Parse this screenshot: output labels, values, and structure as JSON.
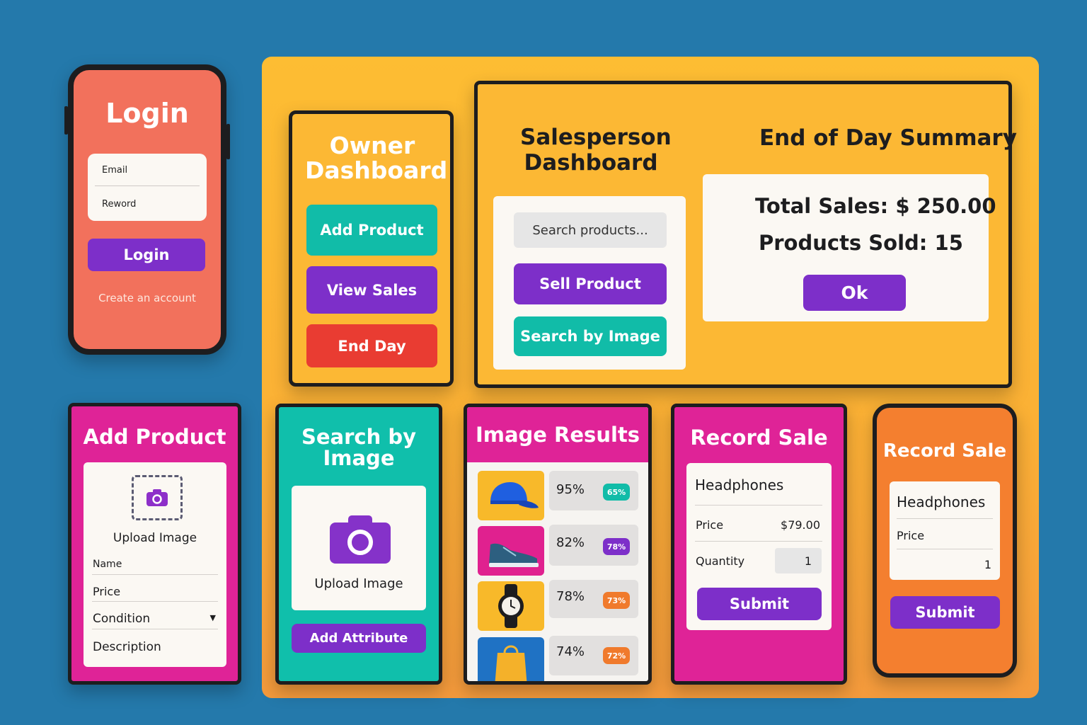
{
  "login": {
    "title": "Login",
    "email_placeholder": "Email",
    "password_placeholder": "Reword",
    "login_label": "Login",
    "create_account": "Create an account"
  },
  "owner": {
    "title": "Owner Dashboard",
    "add_product": "Add Product",
    "view_sales": "View Sales",
    "end_day": "End Day"
  },
  "salesperson": {
    "title": "Salesperson Dashboard",
    "search_placeholder": "Search products...",
    "sell_product": "Sell Product",
    "search_by_image": "Search by Image"
  },
  "summary": {
    "title": "End of Day Summary",
    "total_sales_label": "Total Sales:",
    "total_sales_value": "$ 250.00",
    "products_sold_label": "Products Sold:",
    "products_sold_value": "15",
    "ok": "Ok"
  },
  "add_product": {
    "title": "Add Product",
    "upload": "Upload Image",
    "name": "Name",
    "price": "Price",
    "condition": "Condition",
    "description": "Description"
  },
  "search_image": {
    "title": "Search by Image",
    "upload": "Upload Image",
    "add_attribute": "Add Attribute"
  },
  "image_results": {
    "title": "Image Results",
    "items": [
      {
        "score": "95%",
        "badge": "65%",
        "badge_color": "#11bca8",
        "thumb_bg": "#f8b92a",
        "icon": "cap-icon"
      },
      {
        "score": "82%",
        "badge": "78%",
        "badge_color": "#7d2fc9",
        "thumb_bg": "#e0218f",
        "icon": "sneaker-icon"
      },
      {
        "score": "78%",
        "badge": "73%",
        "badge_color": "#f07a2c",
        "thumb_bg": "#f8b92a",
        "icon": "watch-icon"
      },
      {
        "score": "74%",
        "badge": "72%",
        "badge_color": "#f07a2c",
        "thumb_bg": "#1f72c4",
        "icon": "bag-icon"
      }
    ]
  },
  "record_sale_1": {
    "title": "Record Sale",
    "product": "Headphones",
    "price_label": "Price",
    "price_value": "$79.00",
    "quantity_label": "Quantity",
    "quantity_value": "1",
    "submit": "Submit"
  },
  "record_sale_2": {
    "title": "Record Sale",
    "product": "Headphones",
    "price_label": "Price",
    "quantity_value": "1",
    "submit": "Submit"
  }
}
